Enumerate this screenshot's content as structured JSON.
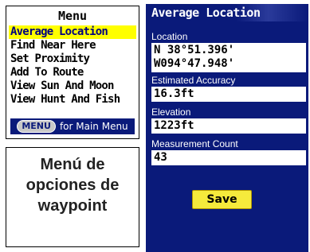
{
  "menu": {
    "title": "Menu",
    "items": [
      {
        "label": "Average Location"
      },
      {
        "label": "Find Near Here"
      },
      {
        "label": "Set Proximity"
      },
      {
        "label": "Add To Route"
      },
      {
        "label": "View Sun And Moon"
      },
      {
        "label": "View Hunt And Fish"
      }
    ],
    "footer_key": "MENU",
    "footer_text": "for Main Menu"
  },
  "caption": {
    "line1": "Menú de",
    "line2": "opciones de",
    "line3": "waypoint"
  },
  "average_location": {
    "title": "Average Location",
    "location_label": "Location",
    "latitude": "N  38°51.396'",
    "longitude": "W094°47.948'",
    "accuracy_label": "Estimated Accuracy",
    "accuracy_value": "16.3ft",
    "elevation_label": "Elevation",
    "elevation_value": "1223ft",
    "count_label": "Measurement Count",
    "count_value": "43",
    "save_label": "Save"
  },
  "colors": {
    "screen_bg": "#0a1a7a",
    "highlight": "#ffff00",
    "button": "#f5ea3c"
  }
}
